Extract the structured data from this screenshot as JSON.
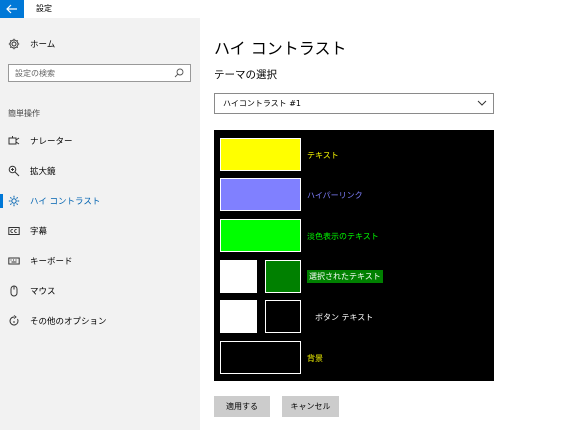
{
  "window": {
    "title": "設定"
  },
  "sidebar": {
    "home_label": "ホーム",
    "search_placeholder": "設定の検索",
    "section_label": "簡単操作",
    "items": [
      {
        "label": "ナレーター",
        "icon": "narrator-icon",
        "active": false
      },
      {
        "label": "拡大鏡",
        "icon": "magnifier-icon",
        "active": false
      },
      {
        "label": "ハイ コントラスト",
        "icon": "high-contrast-icon",
        "active": true
      },
      {
        "label": "字幕",
        "icon": "closed-captions-icon",
        "active": false
      },
      {
        "label": "キーボード",
        "icon": "keyboard-icon",
        "active": false
      },
      {
        "label": "マウス",
        "icon": "mouse-icon",
        "active": false
      },
      {
        "label": "その他のオプション",
        "icon": "other-options-icon",
        "active": false
      }
    ]
  },
  "main": {
    "title": "ハイ コントラスト",
    "theme_label": "テーマの選択",
    "theme_dropdown_value": "ハイコントラスト #1",
    "preview": {
      "text_label": "テキスト",
      "hyperlink_label": "ハイパーリンク",
      "disabled_text_label": "淡色表示のテキスト",
      "selected_text_label": "選択されたテキスト",
      "button_text_label": "ボタン テキスト",
      "background_label": "背景"
    },
    "apply_button": "適用する",
    "cancel_button": "キャンセル"
  },
  "colors": {
    "accent": "#0078d7",
    "text_swatch": "#ffff00",
    "hyperlink_swatch": "#8080ff",
    "disabled_text_swatch": "#00ff00",
    "selected_bg_swatch": "#008000",
    "button_face_swatch": "#ffffff",
    "background_swatch": "#000000"
  }
}
